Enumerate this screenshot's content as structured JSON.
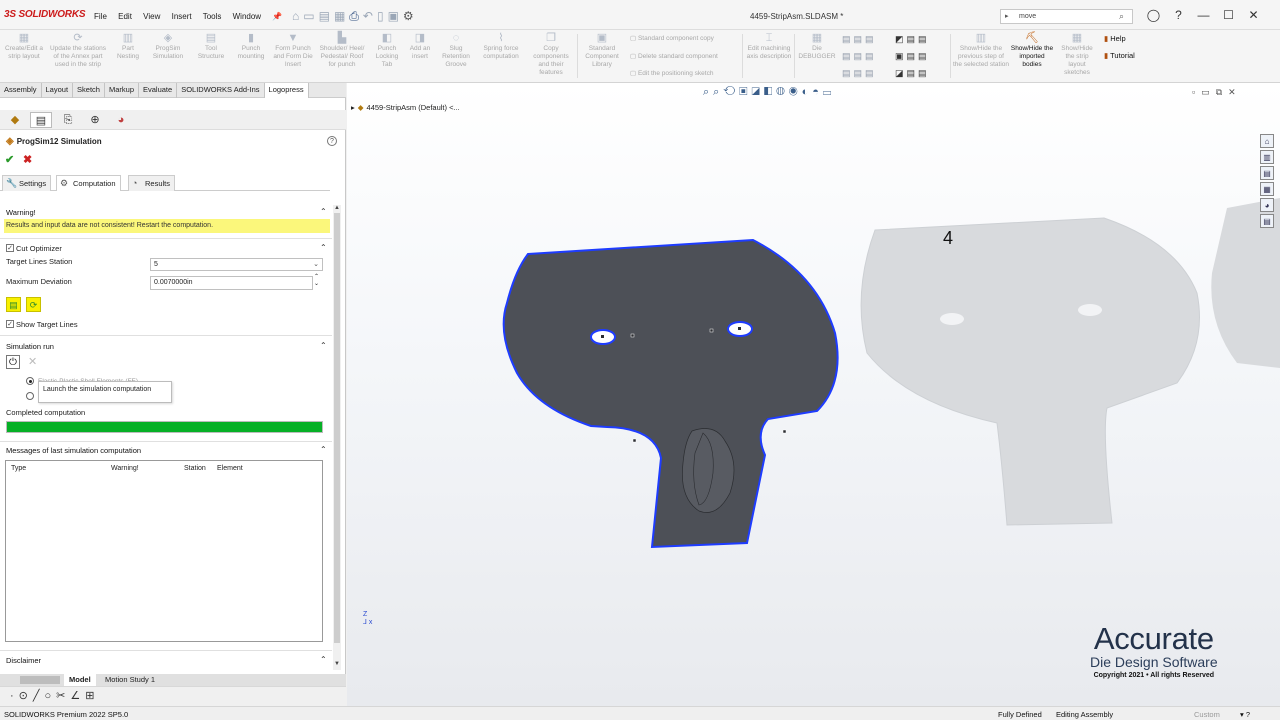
{
  "app": {
    "logo": "SOLIDWORKS",
    "doc_title": "4459-StripAsm.SLDASM *",
    "menu": [
      "File",
      "Edit",
      "View",
      "Insert",
      "Tools",
      "Window"
    ],
    "search_value": "move"
  },
  "ribbon": {
    "buttons": [
      "Create/Edit a strip layout",
      "Update the stations of the Annex part used in the strip",
      "Part Nesting",
      "ProgSim Simulation",
      "Tool Structure",
      "Punch mounting",
      "Form Punch and Form Die Insert",
      "Shoulder/ Heel/ Pedestal/ Roof for punch",
      "Punch Locking Tab",
      "Add an insert",
      "Slug Retention Groove",
      "Spring force computation",
      "Copy components and their features",
      "Standard Component Library",
      "Edit machining axis description",
      "Die DEBUGGER",
      "Show/Hide the previous step of the selected station",
      "Show/Hide the imported bodies",
      "Show/Hide the strip layout sketches"
    ],
    "small_items": [
      "Standard component copy",
      "Delete standard component",
      "Edit the positioning sketch"
    ],
    "help": "Help",
    "tutorial": "Tutorial"
  },
  "command_tabs": [
    "Assembly",
    "Layout",
    "Sketch",
    "Markup",
    "Evaluate",
    "SOLIDWORKS Add-Ins",
    "Logopress"
  ],
  "panel": {
    "title": "ProgSim12 Simulation",
    "tabs": [
      "Settings",
      "Computation",
      "Results"
    ],
    "warning": {
      "title": "Warning!",
      "message": "Results and input data are not consistent! Restart the computation."
    },
    "cut_optimizer": {
      "title": "Cut Optimizer",
      "target_lines_station_label": "Target Lines Station",
      "target_lines_station_value": "5",
      "max_deviation_label": "Maximum Deviation",
      "max_deviation_value": "0.0070000in",
      "show_target_lines": "Show Target Lines"
    },
    "simulation_run": {
      "title": "Simulation run",
      "radio_option": "Elastic-Plastic Shell Elements (FE)",
      "tooltip": "Launch the simulation computation",
      "completed_label": "Completed computation",
      "progress": 1.0
    },
    "messages": {
      "title": "Messages of last simulation computation",
      "columns": [
        "Type",
        "Warning!",
        "Station",
        "Element"
      ]
    },
    "disclaimer": "Disclaimer"
  },
  "bottom_tabs": [
    "Model",
    "Motion Study 1"
  ],
  "status": {
    "product": "SOLIDWORKS Premium 2022 SP5.0",
    "fully_defined": "Fully Defined",
    "mode": "Editing Assembly",
    "custom": "Custom"
  },
  "viewport": {
    "tree_node": "4459-StripAsm (Default) <...",
    "station_label": "4",
    "watermark_title": "Accurate",
    "watermark_subtitle": "Die Design Software",
    "watermark_copyright": "Copyright 2021 • All rights Reserved"
  },
  "colors": {
    "accent": "#cc1a1a",
    "warning_bg": "#fbf77b",
    "progress": "#06b026",
    "part_selected": "#4d5057",
    "part_edge": "#1e3cff",
    "part_ghost": "#d6d8dc"
  }
}
